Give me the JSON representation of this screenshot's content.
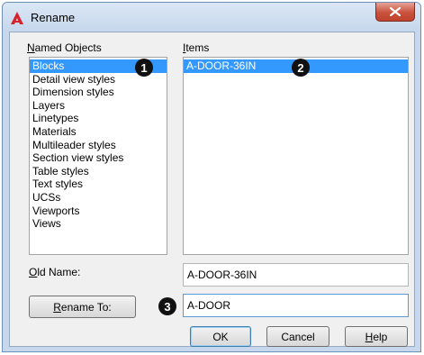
{
  "window": {
    "title": "Rename"
  },
  "named_objects": {
    "label_underlined": "N",
    "label_rest": "amed Objects",
    "items": [
      "Blocks",
      "Detail view styles",
      "Dimension styles",
      "Layers",
      "Linetypes",
      "Materials",
      "Multileader styles",
      "Section view styles",
      "Table styles",
      "Text styles",
      "UCSs",
      "Viewports",
      "Views"
    ],
    "selected": "Blocks"
  },
  "items": {
    "label_underlined": "I",
    "label_rest": "tems",
    "list": [
      "A-DOOR-36IN"
    ]
  },
  "old_name": {
    "label_underlined": "O",
    "label_rest": "ld Name:",
    "value": "A-DOOR-36IN"
  },
  "rename_to": {
    "button_underlined": "R",
    "button_rest": "ename To:",
    "value": "A-DOOR"
  },
  "buttons": {
    "ok": "OK",
    "cancel": "Cancel",
    "help_underlined": "H",
    "help_rest": "elp"
  },
  "callouts": [
    "1",
    "2",
    "3"
  ],
  "colors": {
    "selection": "#3399ff",
    "close_button": "#c9523d",
    "app_icon": "#d4232a"
  },
  "icons": {
    "app": "autocad-a-icon",
    "close": "close-x-icon"
  }
}
